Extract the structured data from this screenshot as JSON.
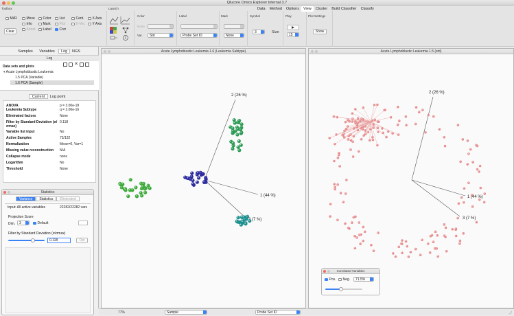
{
  "window_title": "Qlucore Omics Explorer  Internal 3.7",
  "toolbox": {
    "label": "Toolbox",
    "clear_label": "Clear",
    "checkboxes": [
      {
        "label": "Mi/R"
      },
      {
        "label": "Move"
      },
      {
        "label": "Color"
      },
      {
        "label": "List"
      },
      {
        "label": "Cent."
      },
      {
        "label": "X Axis"
      },
      {
        "label": "Info"
      },
      {
        "label": "Mark"
      },
      {
        "label": "Plot"
      },
      {
        "label": "X-Vec"
      },
      {
        "label": "Y Axis"
      },
      {
        "label": "Annot"
      },
      {
        "label": "Label"
      },
      {
        "label": "Corr"
      }
    ]
  },
  "launch": {
    "label": "Launch"
  },
  "color_group": {
    "label": "Color",
    "none_label": "None",
    "var_label": "Var.",
    "var_value": "Std"
  },
  "label_group": {
    "label": "Label",
    "value": "Probe Set ID"
  },
  "mark_group": {
    "label": "Mark",
    "value": "None"
  },
  "symbol_group": {
    "label": "Symbol",
    "size_value": "3",
    "size_label": "Size"
  },
  "play_group": {
    "label": "Play",
    "value": "15"
  },
  "plot_settings": {
    "label": "Plot Settings",
    "show_label": "Show"
  },
  "menu_tabs": [
    "Data",
    "Method",
    "Options",
    "View",
    "Cluster",
    "Build Classifier",
    "Classify"
  ],
  "left_tabs": [
    "Samples",
    "Variables",
    "Log",
    "NGS"
  ],
  "log_title": "Log",
  "datasets": {
    "title": "Data sets and plots",
    "root": "Acute Lymphoblastic Leukemia",
    "items": [
      "1.5 PCA (Variable)",
      "1.6 PCA (Sample)"
    ]
  },
  "current_tabs": [
    "Current",
    "Log point"
  ],
  "properties": [
    {
      "k": "ANOVA",
      "v": "p = 3.00e-18"
    },
    {
      "k": " Leukemia Subtype",
      "v": "q = 2.06e-16"
    },
    {
      "k": "Eliminated factors",
      "v": "None"
    },
    {
      "k": "Filter by Standard Deviation (σ/σmax)",
      "v": "0.118"
    },
    {
      "k": "Variable list input",
      "v": "No"
    },
    {
      "k": "Active Samples",
      "v": "73/132"
    },
    {
      "k": "Normalization",
      "v": "Mean=0, Var=1"
    },
    {
      "k": "Missing value reconstruction",
      "v": "N/A"
    },
    {
      "k": "Collapse mode",
      "v": "none"
    },
    {
      "k": "Logarithm",
      "v": "No"
    },
    {
      "k": "Threshold",
      "v": "None"
    }
  ],
  "statistics": {
    "title": "Statistics",
    "tabs": [
      "Variance",
      "Statistics",
      "Eliminated"
    ],
    "input_label": "Input: All active variables",
    "input_value": "22282/22282 vars",
    "projection_label": "Projection Score",
    "dim_label": "Dim.",
    "dim_value": "3",
    "default_label": "Default",
    "filter_label": "Filter by Standard Deviation (σ/σmax)",
    "filter_value": "0.118",
    "opt_label": "Opt"
  },
  "plot1": {
    "title": "Acute Lymphoblastic Leukemia 1.6 (Leukemia Subtype)",
    "axis1": "1 (44 %)",
    "axis2": "2 (26 %)",
    "axis3": "3 (7 %)"
  },
  "plot2": {
    "title": "Acute Lymphoblastic Leukemia 1.5 (std)",
    "axis1": "1 (44 %)",
    "axis2": "2 (26 %)",
    "axis3": "3 (7 %)"
  },
  "correlated": {
    "title": "Correlated Variables",
    "pos_label": "Pos.",
    "neg_label": "Neg.",
    "value": "71.5%"
  },
  "statusbar": {
    "zoom": "77%",
    "sample_select": "Sample",
    "probe_select": "Probe Set ID"
  },
  "colors": {
    "group_green": "#3daa3a",
    "group_blue": "#2e2c9e",
    "group_teal": "#1f9090",
    "group_dark_green": "#2c9a55",
    "var_pink": "#e68c8c",
    "accent": "#3a82f7"
  }
}
